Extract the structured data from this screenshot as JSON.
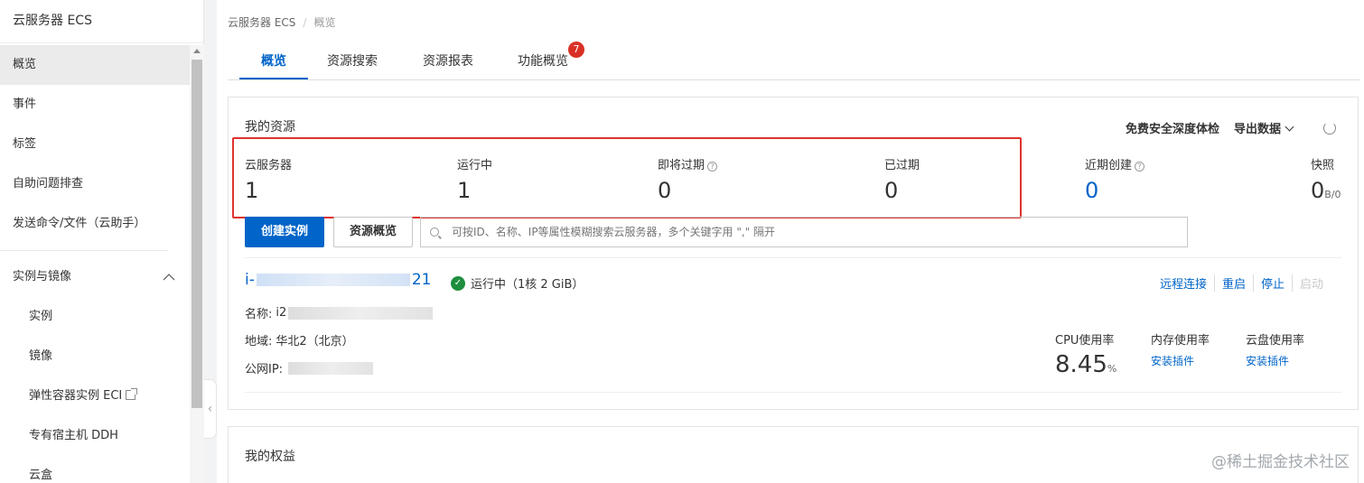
{
  "sidebar": {
    "title": "云服务器 ECS",
    "items": [
      {
        "label": "概览"
      },
      {
        "label": "事件"
      },
      {
        "label": "标签"
      },
      {
        "label": "自助问题排查"
      },
      {
        "label": "发送命令/文件（云助手）"
      }
    ],
    "group": {
      "label": "实例与镜像",
      "children": [
        {
          "label": "实例"
        },
        {
          "label": "镜像"
        },
        {
          "label": "弹性容器实例 ECI"
        },
        {
          "label": "专有宿主机 DDH"
        },
        {
          "label": "云盒"
        }
      ]
    }
  },
  "breadcrumb": {
    "root": "云服务器 ECS",
    "current": "概览"
  },
  "tabs": [
    {
      "label": "概览"
    },
    {
      "label": "资源搜索"
    },
    {
      "label": "资源报表"
    },
    {
      "label": "功能概览",
      "badge": "7"
    }
  ],
  "resources": {
    "title": "我的资源",
    "tools": {
      "security": "免费安全深度体检",
      "export": "导出数据"
    },
    "stats": [
      {
        "label": "云服务器",
        "value": "1"
      },
      {
        "label": "运行中",
        "value": "1"
      },
      {
        "label": "即将过期",
        "value": "0"
      },
      {
        "label": "已过期",
        "value": "0"
      },
      {
        "label": "近期创建",
        "value": "0"
      },
      {
        "label": "快照",
        "value": "0",
        "unit": "B/0"
      }
    ],
    "create_button": "创建实例",
    "overview_button": "资源概览",
    "search_placeholder": "可按ID、名称、IP等属性模糊搜索云服务器，多个关键字用 \",\" 隔开"
  },
  "instance": {
    "id_prefix": "i-",
    "id_suffix": "21",
    "status": "运行中（1核 2 GiB）",
    "actions": {
      "remote": "远程连接",
      "restart": "重启",
      "stop": "停止",
      "start": "启动"
    },
    "name_label": "名称:",
    "name_prefix": "i2",
    "region_label": "地域:",
    "region_value": "华北2（北京）",
    "ip_label": "公网IP:",
    "metrics": {
      "cpu_label": "CPU使用率",
      "cpu_value": "8.45",
      "cpu_unit": "%",
      "mem_label": "内存使用率",
      "mem_link": "安装插件",
      "disk_label": "云盘使用率",
      "disk_link": "安装插件"
    }
  },
  "benefits": {
    "title": "我的权益"
  },
  "watermark": "@稀土掘金技术社区"
}
